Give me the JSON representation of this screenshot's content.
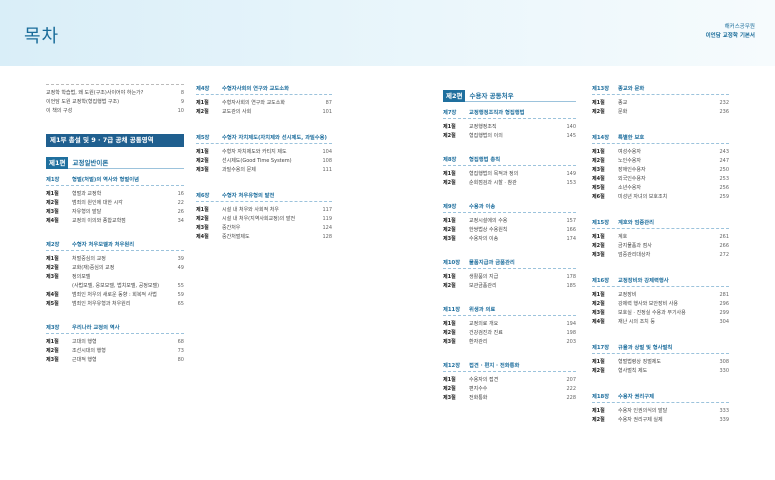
{
  "header": {
    "title": "목차",
    "series_line1": "해커스공무원",
    "series_line2": "이언담 교정학 기본서"
  },
  "intro": [
    {
      "t": "교정학 학습법, 왜 도원(구조)사이어야 하는가?",
      "p": "8"
    },
    {
      "t": "이언담 도원 교정학(형집행법 구조)",
      "p": "9"
    },
    {
      "t": "이 책의 구성",
      "p": "10"
    }
  ],
  "part1": {
    "label": "제1부 총설 및 9 · 7급 공채 공통영역"
  },
  "pyeon1": {
    "tag": "제1편",
    "title": "교정일반이론"
  },
  "col1": [
    {
      "ch": "제1장",
      "title": "형벌(처벌)의 역사와 형벌이념",
      "items": [
        {
          "no": "제1절",
          "t": "형벌과 교정학",
          "p": "16"
        },
        {
          "no": "제2절",
          "t": "범죄의 원인에 대한 시각",
          "p": "22"
        },
        {
          "no": "제3절",
          "t": "자유형의 발달",
          "p": "26"
        },
        {
          "no": "제4절",
          "t": "교정의 이의와 종합교학점",
          "p": "34"
        }
      ]
    },
    {
      "ch": "제2장",
      "title": "수형자 처우모델과 처우원리",
      "items": [
        {
          "no": "제1절",
          "t": "처벌중심의 교정",
          "p": "39"
        },
        {
          "no": "제2절",
          "t": "교화(재)중심의 교정",
          "p": "49"
        },
        {
          "no": "제3절",
          "t": "정의모델",
          "p": ""
        },
        {
          "no": "",
          "t": "(사법모델, 응보모델, 법치모델, 공정모델)",
          "p": "55"
        },
        {
          "no": "제4절",
          "t": "범죄인 처우의 새로운 동향 : 회복적 사법",
          "p": "59"
        },
        {
          "no": "제5절",
          "t": "범죄인 처우유형과 처우원리",
          "p": "65"
        }
      ]
    },
    {
      "ch": "제3장",
      "title": "우리나라 교정의 역사",
      "items": [
        {
          "no": "제1절",
          "t": "고대의 행형",
          "p": "68"
        },
        {
          "no": "제2절",
          "t": "조선시대의 행형",
          "p": "73"
        },
        {
          "no": "제3절",
          "t": "근대적 행형",
          "p": "80"
        }
      ]
    }
  ],
  "col2": [
    {
      "ch": "제4장",
      "title": "수형자사회의 연구와 교도소화",
      "items": [
        {
          "no": "제1절",
          "t": "수형자사회의 연구와 교도소화",
          "p": "87"
        },
        {
          "no": "제2절",
          "t": "교도관의 사회",
          "p": "101"
        }
      ]
    },
    {
      "ch": "제5장",
      "title": "수형자 자치제도(자치제와 선시제도, 과밀수용)",
      "items": [
        {
          "no": "제1절",
          "t": "수형자 자치제도와 카티지 제도",
          "p": "104"
        },
        {
          "no": "제2절",
          "t": "선시제도(Good Time System)",
          "p": "108"
        },
        {
          "no": "제3절",
          "t": "과밀수용의 문제",
          "p": "111"
        }
      ]
    },
    {
      "ch": "제6장",
      "title": "수형자 처우유형의 발전",
      "items": [
        {
          "no": "제1절",
          "t": "시설 내 처우와 사회적 처우",
          "p": "117"
        },
        {
          "no": "제2절",
          "t": "시설 내 처우(지역사회교정)의 발전",
          "p": "119"
        },
        {
          "no": "제3절",
          "t": "중간처우",
          "p": "124"
        },
        {
          "no": "제4절",
          "t": "중간처벌제도",
          "p": "128"
        }
      ]
    }
  ],
  "pyeon2": {
    "tag": "제2편",
    "title": "수용자 공동처우"
  },
  "col3": [
    {
      "ch": "제7장",
      "title": "교정행정조직과 형집행법",
      "items": [
        {
          "no": "제1절",
          "t": "교정행정조직",
          "p": "140"
        },
        {
          "no": "제2절",
          "t": "형집행법의 이의",
          "p": "145"
        }
      ]
    },
    {
      "ch": "제8장",
      "title": "형집행법 총칙",
      "items": [
        {
          "no": "제1절",
          "t": "형집행법의 목적과 정의",
          "p": "149"
        },
        {
          "no": "제2절",
          "t": "순회점검과 시찰 · 참관",
          "p": "153"
        }
      ]
    },
    {
      "ch": "제9장",
      "title": "수용과 이송",
      "items": [
        {
          "no": "제1절",
          "t": "교정시설에의 수용",
          "p": "157"
        },
        {
          "no": "제2절",
          "t": "한쌍법상 수용원칙",
          "p": "166"
        },
        {
          "no": "제3절",
          "t": "수용자의 이송",
          "p": "174"
        }
      ]
    },
    {
      "ch": "제10장",
      "title": "물품지급과 금품관리",
      "items": [
        {
          "no": "제1절",
          "t": "생활품의 지급",
          "p": "178"
        },
        {
          "no": "제2절",
          "t": "보관금품관리",
          "p": "185"
        }
      ]
    },
    {
      "ch": "제11장",
      "title": "위생과 의료",
      "items": [
        {
          "no": "제1절",
          "t": "교정의료 개요",
          "p": "194"
        },
        {
          "no": "제2절",
          "t": "건강검진과 진료",
          "p": "198"
        },
        {
          "no": "제3절",
          "t": "환자관리",
          "p": "203"
        }
      ]
    },
    {
      "ch": "제12장",
      "title": "접견 · 편지 · 전화통화",
      "items": [
        {
          "no": "제1절",
          "t": "수용자의 접견",
          "p": "207"
        },
        {
          "no": "제2절",
          "t": "편지수수",
          "p": "222"
        },
        {
          "no": "제3절",
          "t": "전화통화",
          "p": "228"
        }
      ]
    }
  ],
  "col4": [
    {
      "ch": "제13장",
      "title": "종교와 문화",
      "items": [
        {
          "no": "제1절",
          "t": "종교",
          "p": "232"
        },
        {
          "no": "제2절",
          "t": "문화",
          "p": "236"
        }
      ]
    },
    {
      "ch": "제14장",
      "title": "특별한 보호",
      "items": [
        {
          "no": "제1절",
          "t": "여성수용자",
          "p": "243"
        },
        {
          "no": "제2절",
          "t": "노인수용자",
          "p": "247"
        },
        {
          "no": "제3절",
          "t": "장애인수용자",
          "p": "250"
        },
        {
          "no": "제4절",
          "t": "외국인수용자",
          "p": "253"
        },
        {
          "no": "제5절",
          "t": "소년수용자",
          "p": "256"
        },
        {
          "no": "제6절",
          "t": "미성년 자녀의 보호조치",
          "p": "259"
        }
      ]
    },
    {
      "ch": "제15장",
      "title": "계호와 엄중관리",
      "items": [
        {
          "no": "제1절",
          "t": "계호",
          "p": "261"
        },
        {
          "no": "제2절",
          "t": "금지물품과 점사",
          "p": "266"
        },
        {
          "no": "제3절",
          "t": "엄중관리대상자",
          "p": "272"
        }
      ]
    },
    {
      "ch": "제16장",
      "title": "교정장비와 강제력행사",
      "items": [
        {
          "no": "제1절",
          "t": "교정장비",
          "p": "281"
        },
        {
          "no": "제2절",
          "t": "강제력 행사와 보안장비 사용",
          "p": "296"
        },
        {
          "no": "제3절",
          "t": "보호실 · 진정실 수용과 무기사용",
          "p": "299"
        },
        {
          "no": "제4절",
          "t": "재난 시의 조치 등",
          "p": "304"
        }
      ]
    },
    {
      "ch": "제17장",
      "title": "규율과 상벌 및 형사벌칙",
      "items": [
        {
          "no": "제1절",
          "t": "형벌법령상 징벌제도",
          "p": "308"
        },
        {
          "no": "제2절",
          "t": "형사벌칙 제도",
          "p": "330"
        }
      ]
    },
    {
      "ch": "제18장",
      "title": "수용자 권리구제",
      "items": [
        {
          "no": "제1절",
          "t": "수용자 인권의식의 발달",
          "p": "333"
        },
        {
          "no": "제2절",
          "t": "수용자 권리구제 실제",
          "p": "339"
        }
      ]
    }
  ]
}
